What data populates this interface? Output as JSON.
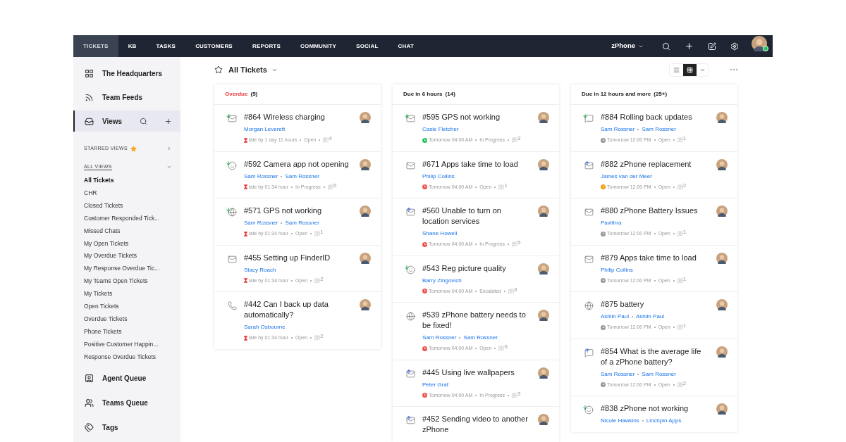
{
  "nav": {
    "tabs": [
      {
        "label": "TICKETS",
        "selected": true
      },
      {
        "label": "KB",
        "selected": false
      },
      {
        "label": "TASKS",
        "selected": false
      },
      {
        "label": "CUSTOMERS",
        "selected": false
      },
      {
        "label": "REPORTS",
        "selected": false
      },
      {
        "label": "COMMUNITY",
        "selected": false
      },
      {
        "label": "SOCIAL",
        "selected": false
      },
      {
        "label": "CHAT",
        "selected": false
      }
    ],
    "department": "zPhone",
    "user_online": true
  },
  "sidebar": {
    "top_items": [
      {
        "label": "The Headquarters",
        "kind": "grid",
        "selected": false
      },
      {
        "label": "Team Feeds",
        "kind": "feed",
        "selected": false
      },
      {
        "label": "Views",
        "kind": "views",
        "selected": true
      }
    ],
    "starred_views": {
      "label": "STARRED VIEWS",
      "expanded": false
    },
    "all_views": {
      "label": "ALL VIEWS",
      "expanded": true,
      "items": [
        {
          "label": "All Tickets",
          "selected": true
        },
        {
          "label": "CHR",
          "selected": false
        },
        {
          "label": "Closed Tickets",
          "selected": false
        },
        {
          "label": "Customer Responded Tick...",
          "selected": false
        },
        {
          "label": "Missed Chats",
          "selected": false
        },
        {
          "label": "My Open Tickets",
          "selected": false
        },
        {
          "label": "My Overdue Tickets",
          "selected": false
        },
        {
          "label": "My Response Overdue Tic...",
          "selected": false
        },
        {
          "label": "My Teams Open Tickets",
          "selected": false
        },
        {
          "label": "My Tickets",
          "selected": false
        },
        {
          "label": "Open Tickets",
          "selected": false
        },
        {
          "label": "Overdue Tickets",
          "selected": false
        },
        {
          "label": "Phone Tickets",
          "selected": false
        },
        {
          "label": "Positive Customer Happin...",
          "selected": false
        },
        {
          "label": "Response Overdue Tickets",
          "selected": false
        }
      ]
    },
    "bottom_items": [
      {
        "label": "Agent Queue",
        "kind": "agent",
        "selected": false
      },
      {
        "label": "Teams Queue",
        "kind": "teams",
        "selected": false
      },
      {
        "label": "Tags",
        "kind": "tags",
        "selected": false
      }
    ]
  },
  "toolbar": {
    "view_title": "All Tickets",
    "layouts": [
      {
        "kind": "list",
        "selected": false
      },
      {
        "kind": "grid",
        "selected": true
      }
    ]
  },
  "columns": [
    {
      "label": "Overdue",
      "count": "(5)",
      "overdue": true,
      "tickets": [
        {
          "kind": "mail-in",
          "title": "#864 Wireless charging",
          "contacts": [
            "Morgan Leverett"
          ],
          "color": "#e53935",
          "due": "late by 1 day 11 hours",
          "status": "Open",
          "threads": "4"
        },
        {
          "kind": "smile-in",
          "title": "#592 Camera app not opening",
          "contacts": [
            "Sam Rossner",
            "Sam Rossner"
          ],
          "color": "#e53935",
          "due": "late by 01:34 hour",
          "status": "In Progress",
          "threads": "5"
        },
        {
          "kind": "globe-in",
          "title": "#571 GPS not working",
          "contacts": [
            "Sam Rossner",
            "Sam Rossner"
          ],
          "color": "#e53935",
          "due": "late by 01:34 hour",
          "status": "Open",
          "threads": "1"
        },
        {
          "kind": "mail",
          "title": "#455 Setting up FinderID",
          "contacts": [
            "Stacy Roach"
          ],
          "color": "#e53935",
          "due": "late by 01:34 hour",
          "status": "Open",
          "threads": "2"
        },
        {
          "kind": "phone",
          "title": "#442 Can I back up data automatically?",
          "contacts": [
            "Sarah Osbourne"
          ],
          "color": "#e53935",
          "due": "late by 01:34 hour",
          "status": "Open",
          "threads": "2"
        }
      ]
    },
    {
      "label": "Due in 6 hours",
      "count": "(14)",
      "overdue": false,
      "tickets": [
        {
          "kind": "mail-in",
          "title": "#595 GPS not working",
          "contacts": [
            "Casie Fletcher"
          ],
          "color": "#22c55e",
          "due": "Tomorrow 04:00 AM",
          "status": "In Progress",
          "threads": "3"
        },
        {
          "kind": "mail",
          "title": "#671 Apps take time to load",
          "contacts": [
            "Philip Collins"
          ],
          "color": "#ef5350",
          "due": "Tomorrow 04:00 AM",
          "status": "Open",
          "threads": "1"
        },
        {
          "kind": "mail-out",
          "title": "#560 Unable to turn on location services",
          "contacts": [
            "Shane Howell"
          ],
          "color": "#ef5350",
          "due": "Tomorrow 04:00 AM",
          "status": "In Progress",
          "threads": "5"
        },
        {
          "kind": "smile-in",
          "title": "#543 Reg picture quality",
          "contacts": [
            "Barry Zingovich"
          ],
          "color": "#ef5350",
          "due": "Tomorrow 04:00 AM",
          "status": "Escalated",
          "threads": "3"
        },
        {
          "kind": "globe",
          "title": "#539 zPhone battery needs to be fixed!",
          "contacts": [
            "Sam Rossner",
            "Sam Rossner"
          ],
          "color": "#ef5350",
          "due": "Tomorrow 04:00 AM",
          "status": "Open",
          "threads": "6"
        },
        {
          "kind": "mail-out",
          "title": "#445 Using live wallpapers",
          "contacts": [
            "Peter Graf"
          ],
          "color": "#ef5350",
          "due": "Tomorrow 04:00 AM",
          "status": "In Progress",
          "threads": "3"
        },
        {
          "kind": "mail-out",
          "title": "#452 Sending video to another zPhone"
        }
      ]
    },
    {
      "label": "Due in 12 hours and more",
      "count": "(25+)",
      "overdue": false,
      "tickets": [
        {
          "kind": "chat-in",
          "title": "#884 Rolling back updates",
          "contacts": [
            "Sam Rossner",
            "Sam Rossner"
          ],
          "color": "#999999",
          "due": "Tomorrow 12:00 PM",
          "status": "Open",
          "threads": "1"
        },
        {
          "kind": "mail-out",
          "title": "#882 zPhone replacement",
          "contacts": [
            "James van der Meer"
          ],
          "color": "#f59e0b",
          "due": "Tomorrow 12:00 PM",
          "status": "Open",
          "threads": "2"
        },
        {
          "kind": "mail",
          "title": "#880 zPhone Battery Issues",
          "contacts": [
            "Pavithra"
          ],
          "color": "#999999",
          "due": "Tomorrow 12:00 PM",
          "status": "Open",
          "threads": "1"
        },
        {
          "kind": "mail",
          "title": "#879 Apps take time to load",
          "contacts": [
            "Philip Collins"
          ],
          "color": "#999999",
          "due": "Tomorrow 12:00 PM",
          "status": "Open",
          "threads": "1"
        },
        {
          "kind": "globe",
          "title": "#875 battery",
          "contacts": [
            "Ashlin Paul",
            "Ashlin Paul"
          ],
          "color": "#999999",
          "due": "Tomorrow 12:00 PM",
          "status": "Open",
          "threads": "1"
        },
        {
          "kind": "chat-out",
          "title": "#854 What is the average life of a zPhone battery?",
          "contacts": [
            "Sam Rossner",
            "Sam Rossner"
          ],
          "color": "#999999",
          "due": "Tomorrow 12:00 PM",
          "status": "Open",
          "threads": "2"
        },
        {
          "kind": "smile-in",
          "title": "#838 zPhone not working",
          "contacts": [
            "Nicole Hawkins",
            "Linchpin Apps"
          ]
        }
      ]
    }
  ]
}
